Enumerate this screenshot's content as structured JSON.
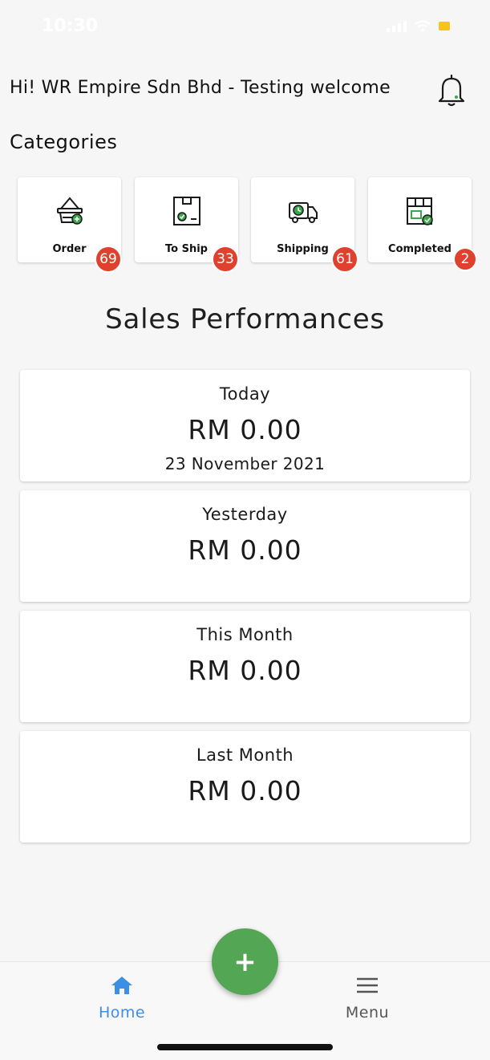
{
  "status_bar": {
    "time": "10:30"
  },
  "header": {
    "greeting": "Hi! WR Empire Sdn Bhd - Testing welcome",
    "bell_icon": "bell-icon"
  },
  "categories": {
    "title": "Categories",
    "items": [
      {
        "label": "Order",
        "count": "69",
        "icon": "basket-icon"
      },
      {
        "label": "To Ship",
        "count": "33",
        "icon": "package-check-icon"
      },
      {
        "label": "Shipping",
        "count": "61",
        "icon": "delivery-truck-icon"
      },
      {
        "label": "Completed",
        "count": "2",
        "icon": "completed-box-icon"
      }
    ]
  },
  "sales": {
    "title": "Sales Performances",
    "cards": [
      {
        "label": "Today",
        "amount": "RM 0.00",
        "date": "23 November 2021"
      },
      {
        "label": "Yesterday",
        "amount": "RM 0.00"
      },
      {
        "label": "This Month",
        "amount": "RM 0.00"
      },
      {
        "label": "Last Month",
        "amount": "RM 0.00"
      }
    ]
  },
  "bottom_nav": {
    "home_label": "Home",
    "menu_label": "Menu",
    "fab_label": "+"
  },
  "colors": {
    "accent": "#3d8fe6",
    "badge": "#e0412f",
    "fab": "#53a653",
    "icon_green": "#3aa54a"
  }
}
